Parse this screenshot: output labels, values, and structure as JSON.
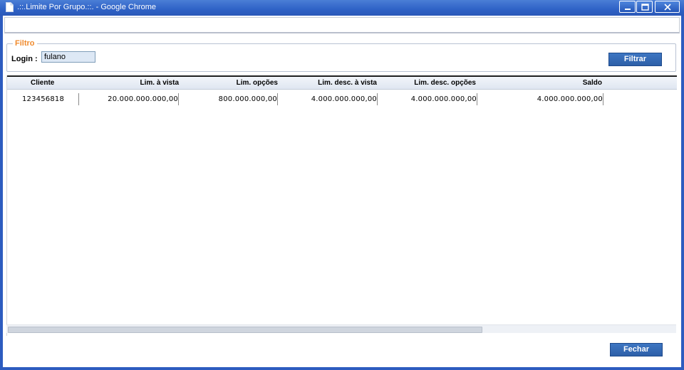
{
  "window": {
    "title": ".::.Limite Por Grupo.::. - Google Chrome",
    "controls": [
      "minimize",
      "maximize",
      "close"
    ]
  },
  "filter": {
    "legend": "Filtro",
    "login_label": "Login :",
    "login_value": "fulano",
    "filter_button": "Filtrar"
  },
  "table": {
    "headers": {
      "cliente": "Cliente",
      "lim_vista": "Lim. à vista",
      "lim_opcoes": "Lim. opções",
      "lim_desc_vista": "Lim. desc. à vista",
      "lim_desc_opcoes": "Lim. desc. opções",
      "saldo": "Saldo"
    },
    "rows": [
      {
        "cliente": "123456818",
        "lim_vista": "20.000.000.000,00",
        "lim_opcoes": "800.000.000,00",
        "lim_desc_vista": "4.000.000.000,00",
        "lim_desc_opcoes": "4.000.000.000,00",
        "saldo": "4.000.000.000,00"
      }
    ]
  },
  "footer": {
    "close_button": "Fechar"
  },
  "colors": {
    "titlebar": "#2f62c6",
    "legend": "#f08a2c",
    "button": "#2d5fa8"
  }
}
